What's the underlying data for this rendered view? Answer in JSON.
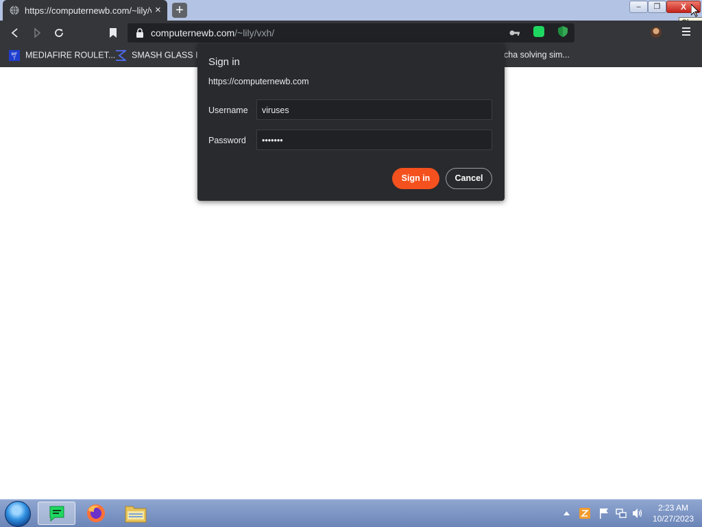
{
  "browser": {
    "tab": {
      "title": "https://computernewb.com/~lily/vxh/",
      "close_glyph": "×"
    },
    "new_tab_glyph": "+",
    "window_controls": {
      "minimize_glyph": "–",
      "maximize_glyph": "❐",
      "close_glyph": "X"
    },
    "tooltip": "Close",
    "address": {
      "host": "computernewb.com",
      "path": "/~lily/vxh/"
    },
    "icons": [
      "back-icon",
      "forward-icon",
      "reload-icon",
      "bookmark-icon",
      "lock-icon",
      "key-icon",
      "extension-icon",
      "shield-icon",
      "profile-avatar",
      "menu-icon"
    ]
  },
  "bookmarks": [
    {
      "label": "MEDIAFIRE ROULET...",
      "icon": "mediafire-icon"
    },
    {
      "label": "SMASH GLASS IN",
      "icon": "sigma-icon"
    },
    {
      "label": "cha solving sim..."
    }
  ],
  "dialog": {
    "title": "Sign in",
    "origin": "https://computernewb.com",
    "username_label": "Username",
    "username_value": "viruses",
    "password_label": "Password",
    "password_value": "•••••••",
    "signin_label": "Sign in",
    "cancel_label": "Cancel"
  },
  "taskbar": {
    "apps": [
      "start-orb",
      "green-app-icon",
      "firefox-icon",
      "file-explorer-icon"
    ],
    "tray": [
      "show-hidden-icons",
      "tray-app-icon",
      "action-center-flag-icon",
      "network-icon",
      "volume-icon"
    ],
    "time": "2:23 AM",
    "date": "10/27/2023"
  },
  "colors": {
    "accent": "#f4511e",
    "dialog_bg": "#292a2d",
    "chrome_bg": "#35363a",
    "titlebar": "#b3c3e3"
  }
}
